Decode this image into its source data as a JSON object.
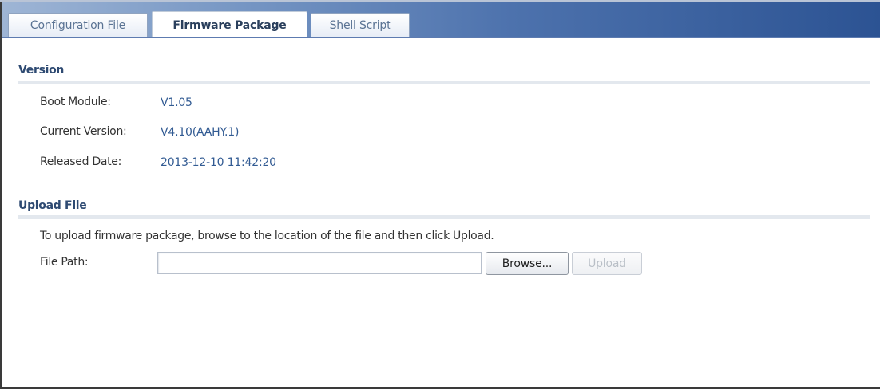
{
  "tabs": [
    {
      "label": "Configuration File",
      "active": false
    },
    {
      "label": "Firmware Package",
      "active": true
    },
    {
      "label": "Shell Script",
      "active": false
    }
  ],
  "version": {
    "title": "Version",
    "boot_module_label": "Boot Module:",
    "boot_module_value": "V1.05",
    "current_version_label": "Current Version:",
    "current_version_value": "V4.10(AAHY.1)",
    "released_date_label": "Released Date:",
    "released_date_value": "2013-12-10 11:42:20"
  },
  "upload": {
    "title": "Upload File",
    "instructions": "To upload firmware package, browse to the location of the file and then click Upload.",
    "file_path_label": "File Path:",
    "file_path_value": "",
    "browse_label": "Browse...",
    "upload_label": "Upload",
    "upload_enabled": false
  },
  "colors": {
    "value_text": "#325b93",
    "section_title": "#2e4a72",
    "tabbar_gradient_start": "#9eb5d5",
    "tabbar_gradient_end": "#2c5393"
  }
}
